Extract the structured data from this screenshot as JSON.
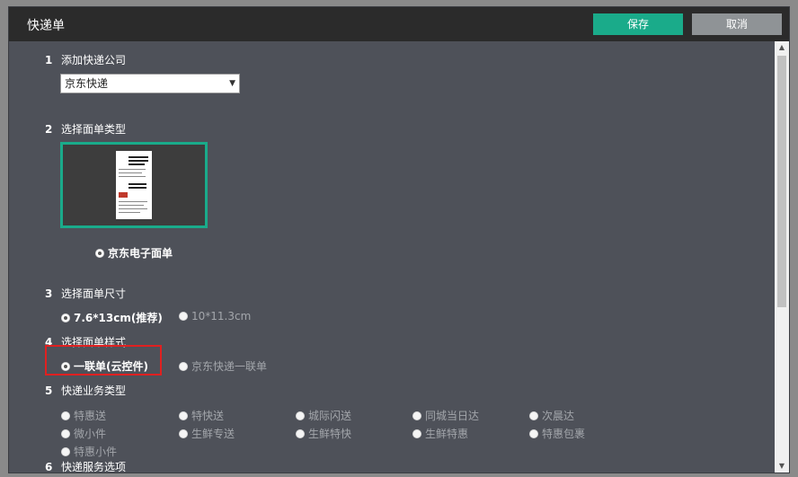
{
  "dialog": {
    "title": "快递单",
    "save_label": "保存",
    "cancel_label": "取消"
  },
  "sections": [
    {
      "num": "1",
      "label": "添加快递公司"
    },
    {
      "num": "2",
      "label": "选择面单类型"
    },
    {
      "num": "3",
      "label": "选择面单尺寸"
    },
    {
      "num": "4",
      "label": "选择面单样式"
    },
    {
      "num": "5",
      "label": "快递业务类型"
    },
    {
      "num": "6",
      "label": "快递服务选项"
    }
  ],
  "company_select": {
    "value": "京东快递"
  },
  "template": {
    "label": "京东电子面单",
    "selected": true
  },
  "sizes": [
    {
      "label": "7.6*13cm(推荐)",
      "selected": true
    },
    {
      "label": "10*11.3cm",
      "selected": false
    }
  ],
  "styles": [
    {
      "label": "一联单(云控件)",
      "selected": true
    },
    {
      "label": "京东快递一联单",
      "selected": false
    }
  ],
  "business_types": [
    "特惠送",
    "特快送",
    "城际闪送",
    "同城当日达",
    "次晨达",
    "微小件",
    "生鲜专送",
    "生鲜特快",
    "生鲜特惠",
    "特惠包裹",
    "特惠小件"
  ],
  "colors": {
    "accent": "#1aab8a",
    "highlight": "#e02020",
    "background": "#4e5159"
  }
}
